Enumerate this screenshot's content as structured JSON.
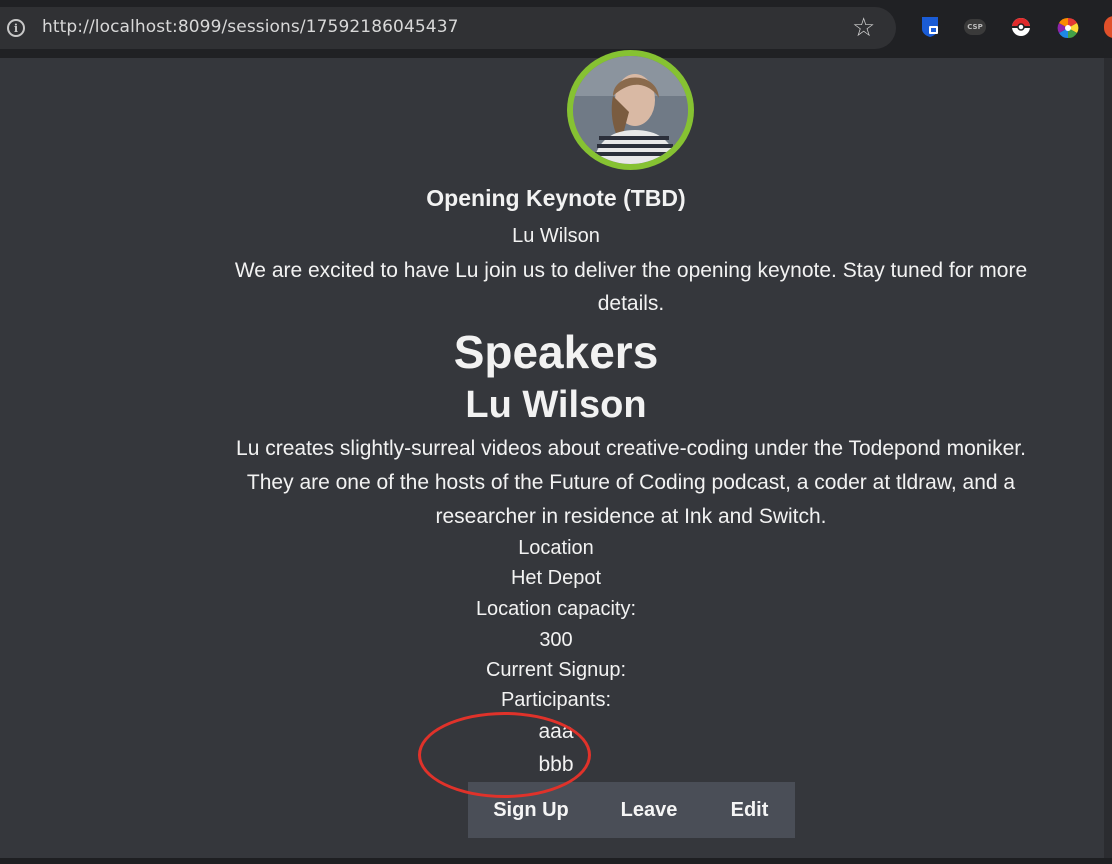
{
  "browser": {
    "url": "http://localhost:8099/sessions/17592186045437",
    "extensions": [
      "bitwarden-icon",
      "csp-icon",
      "pokeball-icon",
      "color-wheel-icon",
      "extension-icon"
    ],
    "ext_csp_label": "CSP"
  },
  "session": {
    "title": "Opening Keynote (TBD)",
    "speaker": "Lu Wilson",
    "description": "We are excited to have Lu join us to deliver the opening keynote. Stay tuned for more details."
  },
  "speakers": {
    "heading": "Speakers",
    "items": [
      {
        "name": "Lu Wilson",
        "bio": "Lu creates slightly-surreal videos about creative-coding under the Todepond moniker. They are one of the hosts of the Future of Coding podcast, a coder at tldraw, and a researcher in residence at Ink and Switch."
      }
    ]
  },
  "details": {
    "location_label": "Location",
    "location_value": "Het Depot",
    "capacity_label": "Location capacity:",
    "capacity_value": "300",
    "signup_label": "Current Signup:",
    "participants_label": "Participants:",
    "participants": [
      "aaa",
      "bbb"
    ]
  },
  "actions": {
    "signup": "Sign Up",
    "leave": "Leave",
    "edit": "Edit"
  },
  "colors": {
    "background": "#35373c",
    "avatar_ring": "#86c232",
    "annotation": "#e0322a",
    "button_group": "#4a4e57"
  }
}
